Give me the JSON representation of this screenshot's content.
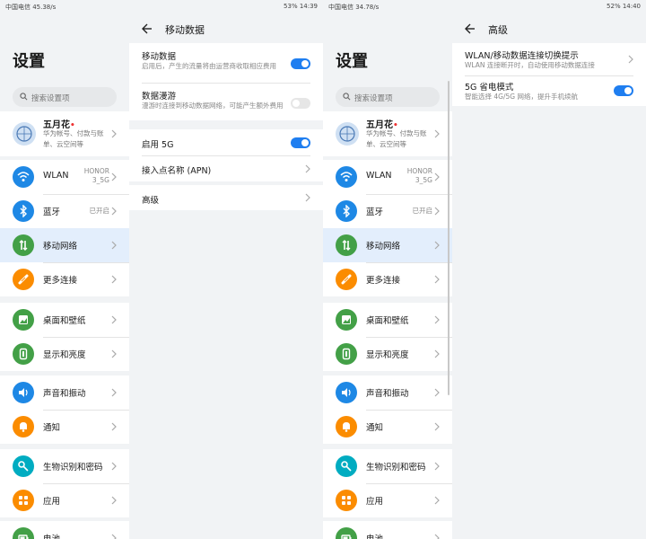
{
  "left": {
    "status": {
      "left": "中国电信 45.38/s",
      "right": "53% 14:39"
    },
    "settings": {
      "title": "设置",
      "search_placeholder": "搜索设置项",
      "account": {
        "name": "五月花",
        "subtitle": "华为帐号、付款与账单、云空间等"
      },
      "items": [
        {
          "label": "WLAN",
          "value": "HONOR 3_5G",
          "icon": "wifi-icon",
          "color": "#1e88e5"
        },
        {
          "label": "蓝牙",
          "value": "已开启",
          "icon": "bluetooth-icon",
          "color": "#1e88e5"
        },
        {
          "label": "移动网络",
          "value": "",
          "icon": "mobile-data-icon",
          "color": "#43a047"
        },
        {
          "label": "更多连接",
          "value": "",
          "icon": "link-icon",
          "color": "#fb8c00"
        },
        {
          "label": "桌面和壁纸",
          "value": "",
          "icon": "wallpaper-icon",
          "color": "#43a047"
        },
        {
          "label": "显示和亮度",
          "value": "",
          "icon": "display-icon",
          "color": "#43a047"
        },
        {
          "label": "声音和振动",
          "value": "",
          "icon": "sound-icon",
          "color": "#1e88e5"
        },
        {
          "label": "通知",
          "value": "",
          "icon": "bell-icon",
          "color": "#fb8c00"
        },
        {
          "label": "生物识别和密码",
          "value": "",
          "icon": "key-icon",
          "color": "#00acc1"
        },
        {
          "label": "应用",
          "value": "",
          "icon": "apps-icon",
          "color": "#fb8c00"
        },
        {
          "label": "电池",
          "value": "",
          "icon": "battery-icon",
          "color": "#43a047"
        }
      ]
    },
    "detail": {
      "title": "移动数据",
      "mobile_data": {
        "title": "移动数据",
        "desc": "启用后，产生的流量将由运营商收取相应费用"
      },
      "roaming": {
        "title": "数据漫游",
        "desc": "漫游时连接到移动数据网络，可能产生额外费用"
      },
      "enable5g": {
        "title": "启用 5G"
      },
      "apn": {
        "title": "接入点名称 (APN)"
      },
      "advanced": {
        "title": "高级"
      }
    }
  },
  "right": {
    "status": {
      "left": "中国电信 34.78/s",
      "right": "52% 14:40"
    },
    "detail": {
      "title": "高级",
      "switch_hint": {
        "title": "WLAN/移动数据连接切换提示",
        "desc": "WLAN 连接断开时，自动使用移动数据连接"
      },
      "power_save": {
        "title": "5G 省电模式",
        "desc": "智能选择 4G/5G 网络，提升手机续航"
      }
    }
  }
}
